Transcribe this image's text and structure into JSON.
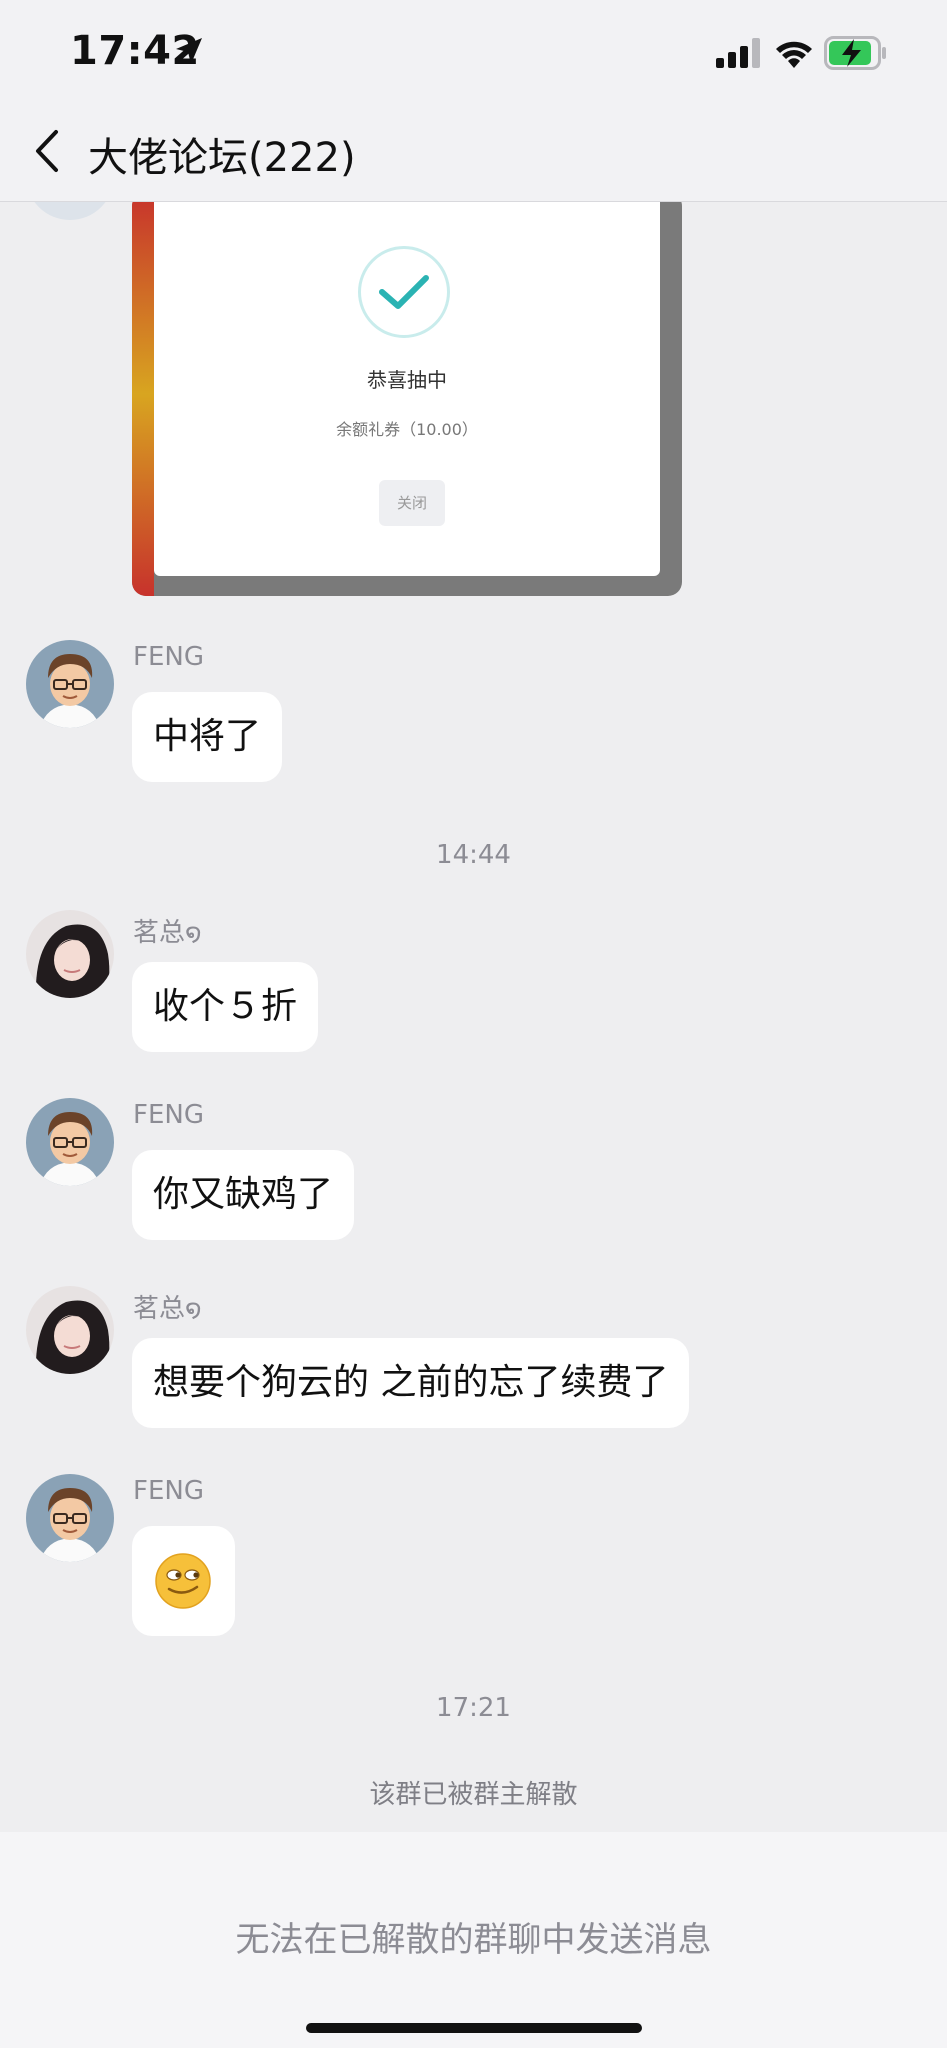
{
  "status_bar": {
    "time": "17:42"
  },
  "header": {
    "title": "大佬论坛(222)"
  },
  "image_message": {
    "title": "恭喜抽中",
    "subtitle": "余额礼券（10.00）",
    "close_label": "关闭",
    "check_color": "#2bb3b3"
  },
  "messages": [
    {
      "sender": "FENG",
      "text": "中将了"
    },
    {
      "sender": "茗总໑",
      "text": "收个５折"
    },
    {
      "sender": "FENG",
      "text": "你又缺鸡了"
    },
    {
      "sender": "茗总໑",
      "text": "想要个狗云的 之前的忘了续费了"
    },
    {
      "sender": "FENG",
      "emoji": "smirk-emoji"
    }
  ],
  "timestamps": {
    "t1": "14:44",
    "t2": "17:21"
  },
  "system_notice": "该群已被群主解散",
  "input_notice": "无法在已解散的群聊中发送消息",
  "colors": {
    "battery_green": "#34c759",
    "background": "#eeeef0",
    "bubble": "#ffffff"
  }
}
